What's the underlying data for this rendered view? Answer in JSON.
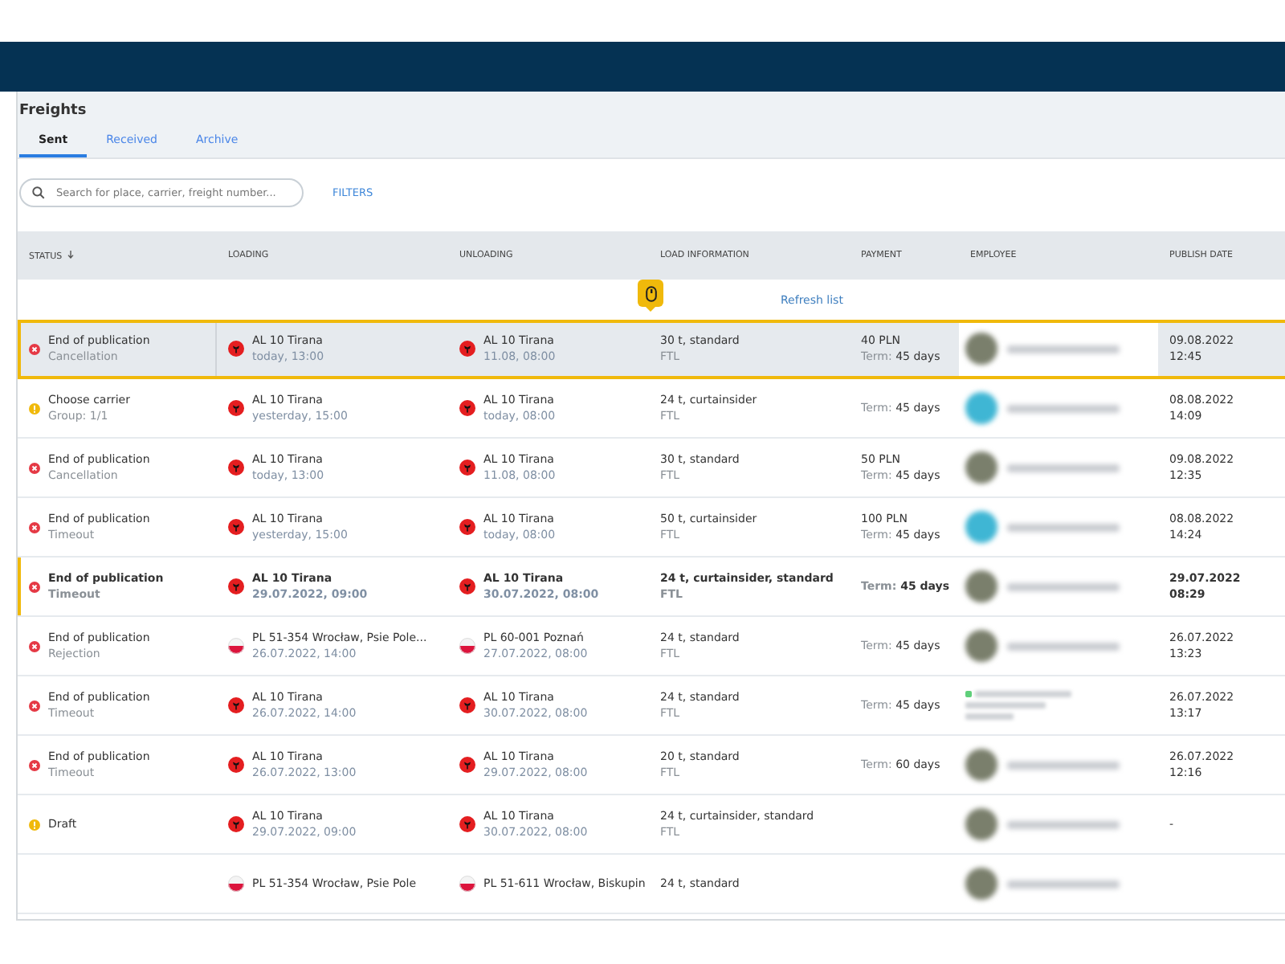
{
  "page": {
    "title": "Freights"
  },
  "tabs": [
    {
      "label": "Sent",
      "selected": true
    },
    {
      "label": "Received",
      "selected": false
    },
    {
      "label": "Archive",
      "selected": false
    }
  ],
  "search": {
    "placeholder": "Search for place, carrier, freight number..."
  },
  "filters_button": "FILTERS",
  "table": {
    "columns": [
      "STATUS",
      "LOADING",
      "UNLOADING",
      "LOAD INFORMATION",
      "PAYMENT",
      "EMPLOYEE",
      "PUBLISH DATE"
    ],
    "refresh_label": "Refresh list",
    "rows": [
      {
        "selected": true,
        "unread": false,
        "status": {
          "kind": "error",
          "title": "End of publication",
          "detail": "Cancellation"
        },
        "loading": {
          "kind": "al",
          "place": "AL 10 Tirana",
          "time": "today, 13:00"
        },
        "unloading": {
          "kind": "al",
          "place": "AL 10 Tirana",
          "time": "11.08, 08:00"
        },
        "load": {
          "info": "30 t, standard",
          "type": "FTL"
        },
        "payment": {
          "amount": "40 PLN",
          "term_label": "Term:",
          "term": "45 days"
        },
        "employee": {
          "kind": "avatar",
          "color": "#7a7f6c"
        },
        "publish": {
          "date": "09.08.2022",
          "time": "12:45"
        }
      },
      {
        "selected": false,
        "unread": false,
        "status": {
          "kind": "warning",
          "title": "Choose carrier",
          "detail": "Group: 1/1"
        },
        "loading": {
          "kind": "al",
          "place": "AL 10 Tirana",
          "time": "yesterday, 15:00"
        },
        "unloading": {
          "kind": "al",
          "place": "AL 10 Tirana",
          "time": "today, 08:00"
        },
        "load": {
          "info": "24 t, curtainsider",
          "type": "FTL"
        },
        "payment": {
          "term_label": "Term:",
          "term": "45 days"
        },
        "employee": {
          "kind": "avatar",
          "color": "#3fb6d4"
        },
        "publish": {
          "date": "08.08.2022",
          "time": "14:09"
        }
      },
      {
        "selected": false,
        "unread": false,
        "status": {
          "kind": "error",
          "title": "End of publication",
          "detail": "Cancellation"
        },
        "loading": {
          "kind": "al",
          "place": "AL 10 Tirana",
          "time": "today, 13:00"
        },
        "unloading": {
          "kind": "al",
          "place": "AL 10 Tirana",
          "time": "11.08, 08:00"
        },
        "load": {
          "info": "30 t, standard",
          "type": "FTL"
        },
        "payment": {
          "amount": "50 PLN",
          "term_label": "Term:",
          "term": "45 days"
        },
        "employee": {
          "kind": "avatar",
          "color": "#7a7f6c"
        },
        "publish": {
          "date": "09.08.2022",
          "time": "12:35"
        }
      },
      {
        "selected": false,
        "unread": false,
        "status": {
          "kind": "error",
          "title": "End of publication",
          "detail": "Timeout"
        },
        "loading": {
          "kind": "al",
          "place": "AL 10 Tirana",
          "time": "yesterday, 15:00"
        },
        "unloading": {
          "kind": "al",
          "place": "AL 10 Tirana",
          "time": "today, 08:00"
        },
        "load": {
          "info": "50 t, curtainsider",
          "type": "FTL"
        },
        "payment": {
          "amount": "100 PLN",
          "term_label": "Term:",
          "term": "45 days"
        },
        "employee": {
          "kind": "avatar",
          "color": "#3fb6d4"
        },
        "publish": {
          "date": "08.08.2022",
          "time": "14:24"
        }
      },
      {
        "selected": false,
        "unread": true,
        "status": {
          "kind": "error",
          "title": "End of publication",
          "detail": "Timeout"
        },
        "loading": {
          "kind": "al",
          "place": "AL 10 Tirana",
          "time": "29.07.2022, 09:00"
        },
        "unloading": {
          "kind": "al",
          "place": "AL 10 Tirana",
          "time": "30.07.2022, 08:00"
        },
        "load": {
          "info": "24 t, curtainsider, standard",
          "type": "FTL"
        },
        "payment": {
          "term_label": "Term:",
          "term": "45 days"
        },
        "employee": {
          "kind": "avatar",
          "color": "#7a7f6c"
        },
        "publish": {
          "date": "29.07.2022",
          "time": "08:29"
        }
      },
      {
        "selected": false,
        "unread": false,
        "status": {
          "kind": "error",
          "title": "End of publication",
          "detail": "Rejection"
        },
        "loading": {
          "kind": "pl",
          "place": "PL 51-354 Wrocław, Psie Pole...",
          "time": "26.07.2022, 14:00"
        },
        "unloading": {
          "kind": "pl",
          "place": "PL 60-001 Poznań",
          "time": "27.07.2022, 08:00"
        },
        "load": {
          "info": "24 t, standard",
          "type": "FTL"
        },
        "payment": {
          "term_label": "Term:",
          "term": "45 days"
        },
        "employee": {
          "kind": "avatar",
          "color": "#7a7f6c"
        },
        "publish": {
          "date": "26.07.2022",
          "time": "13:23"
        }
      },
      {
        "selected": false,
        "unread": false,
        "status": {
          "kind": "error",
          "title": "End of publication",
          "detail": "Timeout"
        },
        "loading": {
          "kind": "al",
          "place": "AL 10 Tirana",
          "time": "26.07.2022, 14:00"
        },
        "unloading": {
          "kind": "al",
          "place": "AL 10 Tirana",
          "time": "30.07.2022, 08:00"
        },
        "load": {
          "info": "24 t, standard",
          "type": "FTL"
        },
        "payment": {
          "term_label": "Term:",
          "term": "45 days"
        },
        "employee": {
          "kind": "list",
          "color": "#5fcf7a"
        },
        "publish": {
          "date": "26.07.2022",
          "time": "13:17"
        }
      },
      {
        "selected": false,
        "unread": false,
        "status": {
          "kind": "error",
          "title": "End of publication",
          "detail": "Timeout"
        },
        "loading": {
          "kind": "al",
          "place": "AL 10 Tirana",
          "time": "26.07.2022, 13:00"
        },
        "unloading": {
          "kind": "al",
          "place": "AL 10 Tirana",
          "time": "29.07.2022, 08:00"
        },
        "load": {
          "info": "20 t, standard",
          "type": "FTL"
        },
        "payment": {
          "term_label": "Term:",
          "term": "60 days"
        },
        "employee": {
          "kind": "avatar",
          "color": "#7a7f6c"
        },
        "publish": {
          "date": "26.07.2022",
          "time": "12:16"
        }
      },
      {
        "selected": false,
        "unread": false,
        "status": {
          "kind": "warning",
          "title": "Draft"
        },
        "loading": {
          "kind": "al",
          "place": "AL 10 Tirana",
          "time": "29.07.2022, 09:00"
        },
        "unloading": {
          "kind": "al",
          "place": "AL 10 Tirana",
          "time": "30.07.2022, 08:00"
        },
        "load": {
          "info": "24 t, curtainsider, standard",
          "type": "FTL"
        },
        "employee": {
          "kind": "avatar",
          "color": "#7a7f6c"
        },
        "publish": {
          "date": "-"
        }
      },
      {
        "selected": false,
        "unread": false,
        "status": {
          "kind": "none"
        },
        "loading": {
          "kind": "pl",
          "place": "PL 51-354 Wrocław, Psie Pole"
        },
        "unloading": {
          "kind": "pl",
          "place": "PL 51-611 Wrocław, Biskupin"
        },
        "load": {
          "info": "24 t, standard"
        },
        "employee": {
          "kind": "avatar",
          "color": "#7a7f6c"
        }
      }
    ]
  }
}
